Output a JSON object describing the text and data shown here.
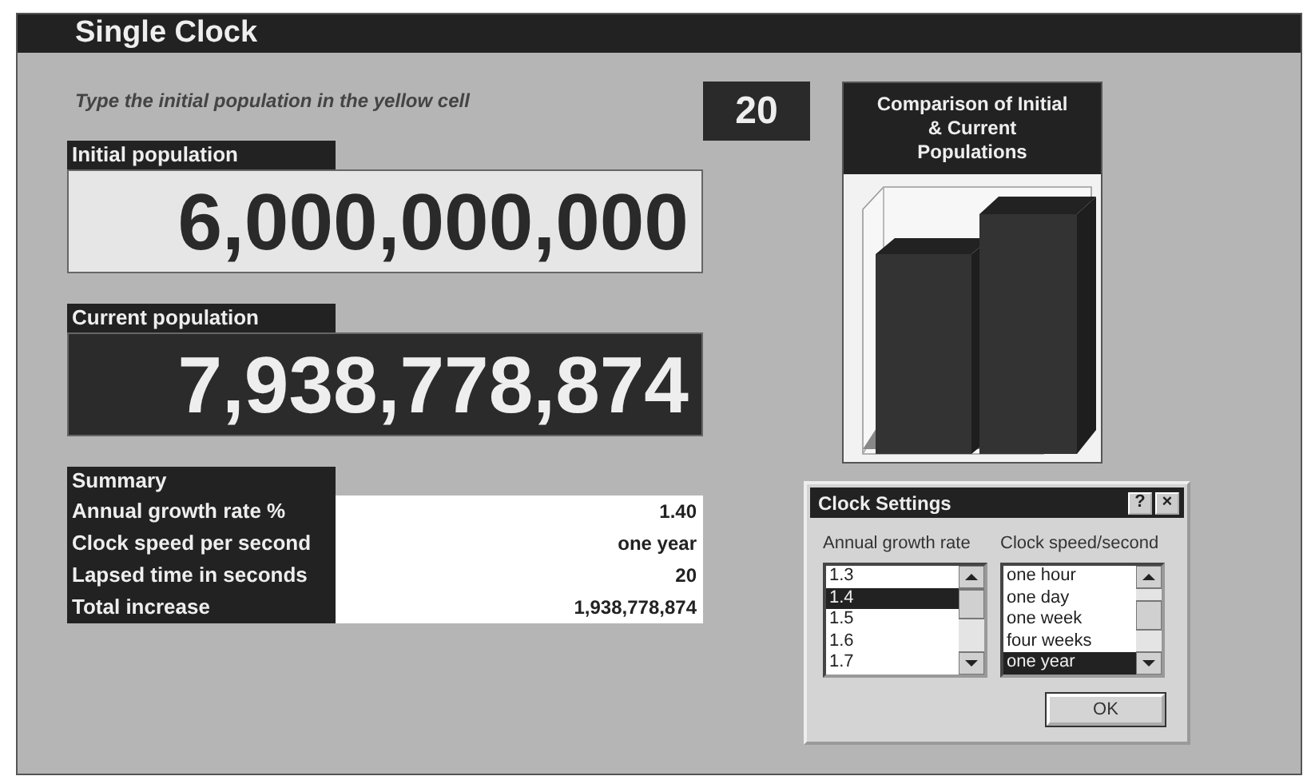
{
  "window": {
    "title": "Single Clock"
  },
  "instruction": "Type the initial population in the yellow cell",
  "elapsed_seconds": "20",
  "initial_population": {
    "label": "Initial population",
    "value": "6,000,000,000"
  },
  "current_population": {
    "label": "Current population",
    "value": "7,938,778,874"
  },
  "summary": {
    "title": "Summary",
    "rows": [
      {
        "label": "Annual growth rate %",
        "value": "1.40"
      },
      {
        "label": "Clock speed per second",
        "value": "one year"
      },
      {
        "label": "Lapsed time in seconds",
        "value": "20"
      },
      {
        "label": "Total increase",
        "value": "1,938,778,874"
      }
    ]
  },
  "chart": {
    "title": "Comparison of Initial & Current Populations"
  },
  "dialog": {
    "title": "Clock Settings",
    "help": "?",
    "close": "×",
    "lists": [
      {
        "label": "Annual growth rate",
        "items": [
          {
            "text": "1.3",
            "selected": false
          },
          {
            "text": "1.4",
            "selected": true
          },
          {
            "text": "1.5",
            "selected": false
          },
          {
            "text": "1.6",
            "selected": false
          },
          {
            "text": "1.7",
            "selected": false
          }
        ]
      },
      {
        "label": "Clock speed/second",
        "items": [
          {
            "text": "one hour",
            "selected": false
          },
          {
            "text": "one day",
            "selected": false
          },
          {
            "text": "one week",
            "selected": false
          },
          {
            "text": "four weeks",
            "selected": false
          },
          {
            "text": "one year",
            "selected": true
          }
        ]
      }
    ],
    "ok": "OK"
  }
}
